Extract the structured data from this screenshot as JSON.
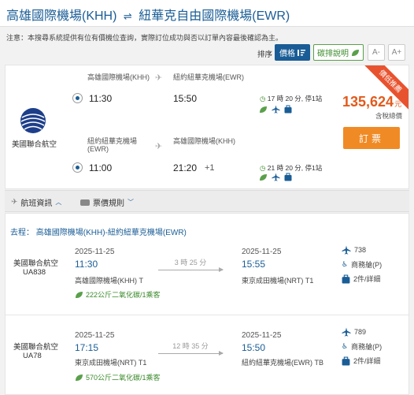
{
  "header": {
    "origin": "高雄國際機場(KHH)",
    "arrow": "⇌",
    "destination": "紐華克自由國際機場(EWR)"
  },
  "notice": "注意：本搜尋系統提供有位有價機位查詢，實際訂位成功與否以訂單內容最後確認為主。",
  "sort": {
    "label": "排序",
    "price_label": "價格",
    "help_label": "碳排說明",
    "font_smaller": "A-",
    "font_larger": "A+"
  },
  "offer": {
    "ribbon": "價低推薦",
    "airline": "美國聯合航空",
    "outbound": {
      "from_airport": "高雄國際機場(KHH)",
      "to_airport": "紐約紐華克機場(EWR)",
      "dep_time": "11:30",
      "arr_time": "15:50",
      "duration": "17 時 20 分, 停1站"
    },
    "return": {
      "from_airport": "紐約紐華克機場",
      "from_airport_2": "(EWR)",
      "to_airport": "高雄國際機場(KHH)",
      "dep_time": "11:00",
      "arr_time": "21:20",
      "plus_day": "+1",
      "duration": "21 時 20 分, 停1站"
    },
    "price": "135,624",
    "price_unit": "元",
    "tax_note": "含稅總價",
    "book_label": "訂票"
  },
  "tabs": {
    "flight_info": "航班資訊",
    "fare_rules": "票價規則"
  },
  "detail": {
    "route_prefix": "去程：",
    "route": "高雄國際機場(KHH)-紐約紐華克機場(EWR)",
    "legs": [
      {
        "airline": "美國聯合航空",
        "flight_no": "UA838",
        "dep_date": "2025-11-25",
        "dep_time": "11:30",
        "dep_airport": "高雄國際機場(KHH) T",
        "duration": "3 時 25 分",
        "arr_date": "2025-11-25",
        "arr_time": "15:55",
        "arr_airport": "東京成田機場(NRT) T1",
        "co2": "222公斤二氧化碳/1乘客",
        "aircraft": "738",
        "cabin": "商務艙(P)",
        "baggage": "2件/詳細"
      },
      {
        "airline": "美國聯合航空",
        "flight_no": "UA78",
        "dep_date": "2025-11-25",
        "dep_time": "17:15",
        "dep_airport": "東京成田機場(NRT) T1",
        "duration": "12 時 35 分",
        "arr_date": "2025-11-25",
        "arr_time": "15:50",
        "arr_airport": "紐約紐華克機場(EWR) TB",
        "co2": "570公斤二氧化碳/1乘客",
        "aircraft": "789",
        "cabin": "商務艙(P)",
        "baggage": "2件/詳細"
      }
    ]
  },
  "colors": {
    "brand_blue": "#1a5d96",
    "price_orange": "#e25a1c",
    "book_orange": "#f08a24",
    "eco_green": "#3a8a2a",
    "ribbon_red": "#e8532f"
  }
}
